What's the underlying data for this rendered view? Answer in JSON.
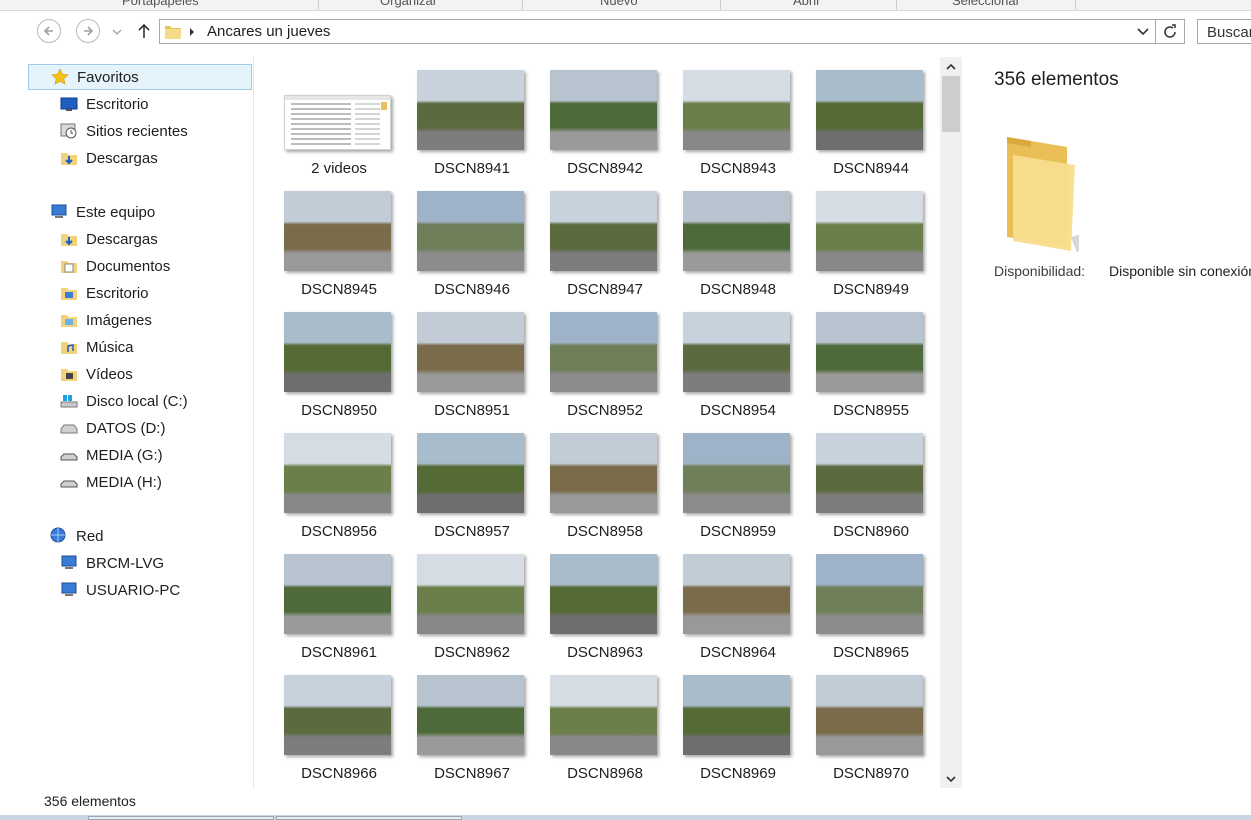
{
  "ribbon": {
    "groups": [
      "Portapapeles",
      "Organizar",
      "Nuevo",
      "Abrir",
      "Seleccionar"
    ]
  },
  "address": {
    "path": "Ancares un jueves",
    "search_placeholder": "Buscar"
  },
  "navpane": {
    "favorites": {
      "label": "Favoritos",
      "items": [
        "Escritorio",
        "Sitios recientes",
        "Descargas"
      ]
    },
    "computer": {
      "label": "Este equipo",
      "items": [
        "Descargas",
        "Documentos",
        "Escritorio",
        "Imágenes",
        "Música",
        "Vídeos",
        "Disco local (C:)",
        "DATOS (D:)",
        "MEDIA (G:)",
        "MEDIA (H:)"
      ]
    },
    "network": {
      "label": "Red",
      "items": [
        "BRCM-LVG",
        "USUARIO-PC"
      ]
    }
  },
  "files": [
    "2 videos",
    "DSCN8941",
    "DSCN8942",
    "DSCN8943",
    "DSCN8944",
    "DSCN8945",
    "DSCN8946",
    "DSCN8947",
    "DSCN8948",
    "DSCN8949",
    "DSCN8950",
    "DSCN8951",
    "DSCN8952",
    "DSCN8954",
    "DSCN8955",
    "DSCN8956",
    "DSCN8957",
    "DSCN8958",
    "DSCN8959",
    "DSCN8960",
    "DSCN8961",
    "DSCN8962",
    "DSCN8963",
    "DSCN8964",
    "DSCN8965",
    "DSCN8966",
    "DSCN8967",
    "DSCN8968",
    "DSCN8969",
    "DSCN8970"
  ],
  "details": {
    "count": "356 elementos",
    "availability_label": "Disponibilidad:",
    "availability_value": "Disponible sin conexión"
  },
  "status": {
    "count": "356 elementos"
  },
  "colors": {
    "folder": "#f2d27a",
    "selection": "#e5f3fb",
    "accent": "#3a7bd5"
  }
}
